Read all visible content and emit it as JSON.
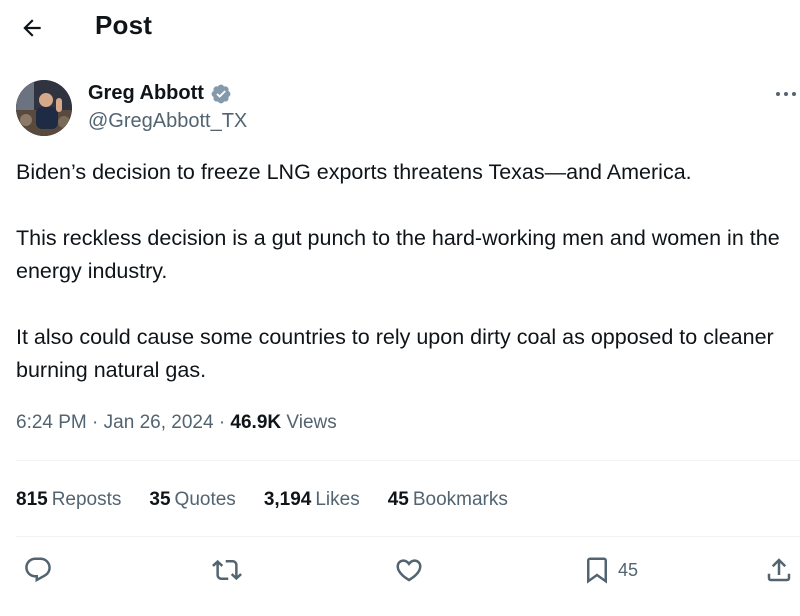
{
  "header": {
    "title": "Post",
    "back_icon": "arrow-left-icon"
  },
  "author": {
    "name": "Greg Abbott",
    "handle": "@GregAbbott_TX",
    "verified_color": "#829aab"
  },
  "tweet": {
    "paragraphs": [
      "Biden’s decision to freeze LNG exports threatens Texas—and America.",
      "This reckless decision is a gut punch to the hard-working men and women in the energy industry.",
      "It also could cause some countries to rely upon dirty coal as opposed to cleaner burning natural gas."
    ]
  },
  "meta": {
    "time": "6:24 PM",
    "sep1": "·",
    "date": "Jan 26, 2024",
    "sep2": "·",
    "views_count": "46.9K",
    "views_label": "Views"
  },
  "stats": {
    "reposts": {
      "count": "815",
      "label": "Reposts"
    },
    "quotes": {
      "count": "35",
      "label": "Quotes"
    },
    "likes": {
      "count": "3,194",
      "label": "Likes"
    },
    "bookmarks": {
      "count": "45",
      "label": "Bookmarks"
    }
  },
  "actions": {
    "reply_icon": "reply-icon",
    "repost_icon": "repost-icon",
    "like_icon": "heart-icon",
    "bookmark_icon": "bookmark-icon",
    "bookmark_count": "45",
    "share_icon": "share-icon"
  },
  "colors": {
    "text": "#0f1419",
    "secondary": "#536471",
    "divider": "#eff3f4"
  }
}
